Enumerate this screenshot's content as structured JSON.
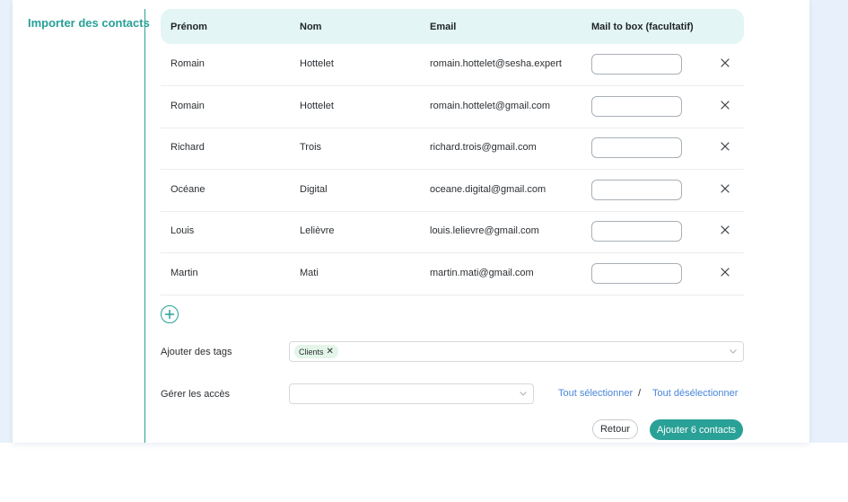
{
  "sidebar": {
    "import_contacts": "Importer des contacts"
  },
  "table": {
    "headers": {
      "first_name": "Prénom",
      "last_name": "Nom",
      "email": "Email",
      "mail_to_box": "Mail to box (facultatif)"
    },
    "rows": [
      {
        "first_name": "Romain",
        "last_name": "Hottelet",
        "email": "romain.hottelet@sesha.expert",
        "mail_to_box": ""
      },
      {
        "first_name": "Romain",
        "last_name": "Hottelet",
        "email": "romain.hottelet@gmail.com",
        "mail_to_box": ""
      },
      {
        "first_name": "Richard",
        "last_name": "Trois",
        "email": "richard.trois@gmail.com",
        "mail_to_box": ""
      },
      {
        "first_name": "Océane",
        "last_name": "Digital",
        "email": "oceane.digital@gmail.com",
        "mail_to_box": ""
      },
      {
        "first_name": "Louis",
        "last_name": "Lelièvre",
        "email": "louis.lelievre@gmail.com",
        "mail_to_box": ""
      },
      {
        "first_name": "Martin",
        "last_name": "Mati",
        "email": "martin.mati@gmail.com",
        "mail_to_box": ""
      }
    ],
    "remove_icon": "close-icon"
  },
  "add_row_icon": "plus-circle-icon",
  "tags": {
    "label": "Ajouter des tags",
    "selected": [
      {
        "label": "Clients"
      }
    ],
    "dropdown_icon": "chevron-down-icon"
  },
  "access": {
    "label": "Gérer les accès",
    "value": "",
    "select_all": "Tout sélectionner",
    "separator": "/",
    "deselect_all": "Tout désélectionner"
  },
  "actions": {
    "back": "Retour",
    "submit": "Ajouter 6 contacts"
  },
  "colors": {
    "accent": "#2aa197",
    "header_bg": "#e3f5f4",
    "link": "#4a86d9",
    "tag_bg": "#e3f5e8",
    "page_bg": "#e8f1fb"
  }
}
